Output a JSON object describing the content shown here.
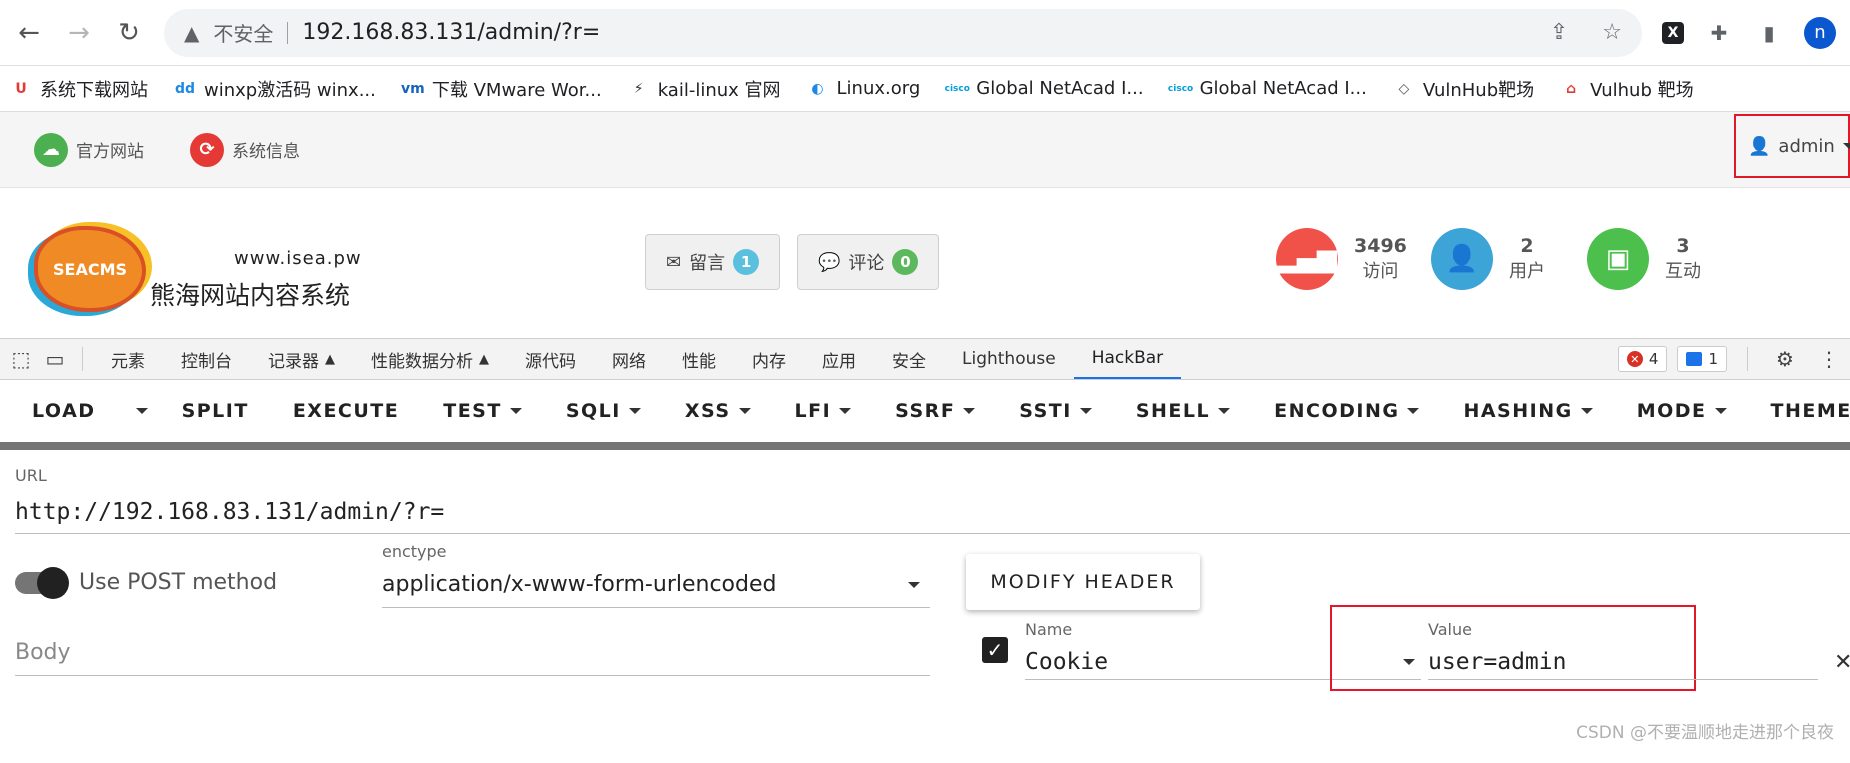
{
  "browser": {
    "address": {
      "security_label": "不安全",
      "url": "192.168.83.131/admin/?r="
    },
    "profile_initial": "n"
  },
  "bookmarks": [
    {
      "label": "系统下载网站",
      "icon": "colorful-u-icon",
      "icon_char": "U",
      "color": "#e53935"
    },
    {
      "label": "winxp激活码 winx...",
      "icon": "dd-icon",
      "icon_char": "dd",
      "color": "#1e88e5"
    },
    {
      "label": "下载 VMware Wor...",
      "icon": "vmware-icon",
      "icon_char": "vm",
      "color": "#1565c0"
    },
    {
      "label": "kail-linux 官网",
      "icon": "kali-dragon-icon",
      "icon_char": "⚡",
      "color": "#333333"
    },
    {
      "label": "Linux.org",
      "icon": "globe-icon",
      "icon_char": "◐",
      "color": "#1e88e5"
    },
    {
      "label": "Global NetAcad I...",
      "icon": "cisco-icon",
      "icon_char": "cisco",
      "color": "#049fd9"
    },
    {
      "label": "Global NetAcad I...",
      "icon": "cisco-icon",
      "icon_char": "cisco",
      "color": "#049fd9"
    },
    {
      "label": "VulnHub靶场",
      "icon": "cube-icon",
      "icon_char": "◇",
      "color": "#555555"
    },
    {
      "label": "Vulhub 靶场",
      "icon": "vulhub-icon",
      "icon_char": "⌂",
      "color": "#e53935"
    }
  ],
  "admin": {
    "top_links": [
      {
        "label": "官方网站",
        "icon": "cloud-upload-icon",
        "color": "#4caf50"
      },
      {
        "label": "系统信息",
        "icon": "refresh-icon",
        "color": "#e53935"
      }
    ],
    "user_label": "admin",
    "site_url": "www.isea.pw",
    "site_name": "熊海网站内容系统",
    "logo_text": "SEACMS",
    "message_button": {
      "label": "留言",
      "count": "1",
      "color": "#5bc0de"
    },
    "comment_button": {
      "label": "评论",
      "count": "0",
      "color": "#5cb85c"
    },
    "stats": [
      {
        "value": "3496",
        "label": "访问",
        "icon": "signal-bars-icon",
        "color": "#f0524a"
      },
      {
        "value": "2",
        "label": "用户",
        "icon": "user-icon",
        "color": "#3da4d8"
      },
      {
        "value": "3",
        "label": "互动",
        "icon": "money-icon",
        "color": "#4cbf4c"
      }
    ]
  },
  "devtools": {
    "tabs": [
      "元素",
      "控制台",
      "记录器",
      "性能数据分析",
      "源代码",
      "网络",
      "性能",
      "内存",
      "应用",
      "安全",
      "Lighthouse",
      "HackBar"
    ],
    "active_tab": "HackBar",
    "errors": "4",
    "messages": "1"
  },
  "hackbar": {
    "toolbar": [
      "LOAD",
      "SPLIT",
      "EXECUTE",
      "TEST",
      "SQLI",
      "XSS",
      "LFI",
      "SSRF",
      "SSTI",
      "SHELL",
      "ENCODING",
      "HASHING",
      "MODE",
      "THEME"
    ],
    "url_label": "URL",
    "url_value": "http://192.168.83.131/admin/?r=",
    "post_toggle_label": "Use POST method",
    "post_enabled": true,
    "enctype_label": "enctype",
    "enctype_value": "application/x-www-form-urlencoded",
    "modify_header_label": "MODIFY HEADER",
    "body_placeholder": "Body",
    "header": {
      "enabled": true,
      "name_label": "Name",
      "name_value": "Cookie",
      "value_label": "Value",
      "value_value": "user=admin"
    }
  },
  "watermark": "CSDN @不要温顺地走进那个良夜"
}
